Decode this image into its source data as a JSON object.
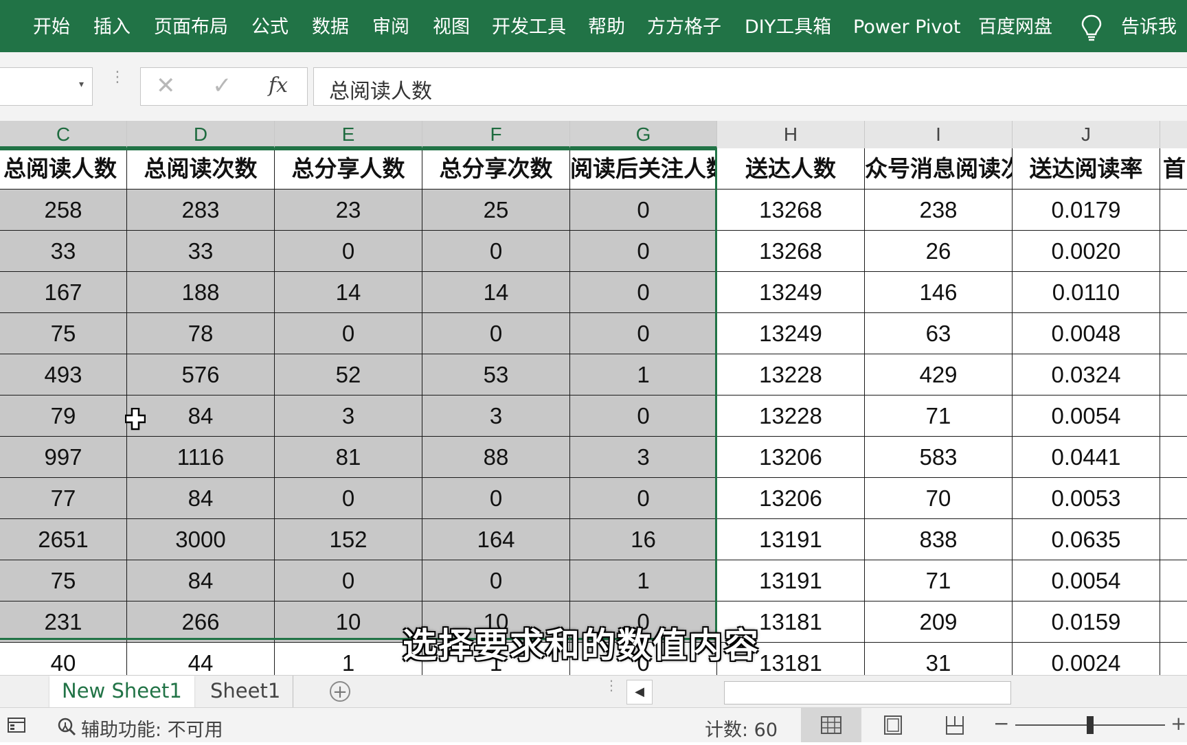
{
  "ribbon": {
    "tabs": [
      "开始",
      "插入",
      "页面布局",
      "公式",
      "数据",
      "审阅",
      "视图",
      "开发工具",
      "帮助",
      "方方格子",
      "DIY工具箱",
      "Power Pivot",
      "百度网盘"
    ],
    "tellme": "告诉我"
  },
  "formula_bar": {
    "name_box": "",
    "cancel_icon": "✕",
    "enter_icon": "✓",
    "fx_label": "fx",
    "value": "总阅读人数"
  },
  "grid": {
    "columns": [
      "C",
      "D",
      "E",
      "F",
      "G",
      "H",
      "I",
      "J"
    ],
    "selected_columns": [
      "C",
      "D",
      "E",
      "F",
      "G"
    ],
    "header_row": [
      "总阅读人数",
      "总阅读次数",
      "总分享人数",
      "总分享次数",
      "阅读后关注人数",
      "送达人数",
      "公众号消息阅读次数",
      "送达阅读率",
      "首次"
    ],
    "header_row_visible": [
      "总阅读人数",
      "总阅读次数",
      "总分享人数",
      "总分享次数",
      "阅读后关注人数",
      "送达人数",
      "众号消息阅读次",
      "送达阅读率",
      "首"
    ],
    "rows": [
      [
        "258",
        "283",
        "23",
        "25",
        "0",
        "13268",
        "238",
        "0.0179"
      ],
      [
        "33",
        "33",
        "0",
        "0",
        "0",
        "13268",
        "26",
        "0.0020"
      ],
      [
        "167",
        "188",
        "14",
        "14",
        "0",
        "13249",
        "146",
        "0.0110"
      ],
      [
        "75",
        "78",
        "0",
        "0",
        "0",
        "13249",
        "63",
        "0.0048"
      ],
      [
        "493",
        "576",
        "52",
        "53",
        "1",
        "13228",
        "429",
        "0.0324"
      ],
      [
        "79",
        "84",
        "3",
        "3",
        "0",
        "13228",
        "71",
        "0.0054"
      ],
      [
        "997",
        "1116",
        "81",
        "88",
        "3",
        "13206",
        "583",
        "0.0441"
      ],
      [
        "77",
        "84",
        "0",
        "0",
        "0",
        "13206",
        "70",
        "0.0053"
      ],
      [
        "2651",
        "3000",
        "152",
        "164",
        "16",
        "13191",
        "838",
        "0.0635"
      ],
      [
        "75",
        "84",
        "0",
        "0",
        "1",
        "13191",
        "71",
        "0.0054"
      ],
      [
        "231",
        "266",
        "10",
        "10",
        "0",
        "13181",
        "209",
        "0.0159"
      ],
      [
        "40",
        "44",
        "1",
        "1",
        "0",
        "13181",
        "31",
        "0.0024"
      ]
    ]
  },
  "subtitle": "选择要求和的数值内容",
  "sheets": {
    "tabs": [
      "New Sheet1",
      "Sheet1"
    ],
    "active": "New Sheet1",
    "add_label": "+"
  },
  "status": {
    "accessibility": "辅助功能: 不可用",
    "count": "计数: 60",
    "zoom_minus": "−",
    "zoom_plus": "+"
  },
  "colors": {
    "accent": "#217346",
    "selection_fill": "#c8c8c8"
  },
  "icons": [
    "lightbulb-icon",
    "cancel-icon",
    "enter-icon",
    "function-icon",
    "cell-cursor-icon",
    "add-sheet-icon",
    "scroll-left-icon",
    "macro-record-icon",
    "accessibility-icon",
    "normal-view-icon",
    "page-layout-view-icon",
    "page-break-view-icon"
  ]
}
